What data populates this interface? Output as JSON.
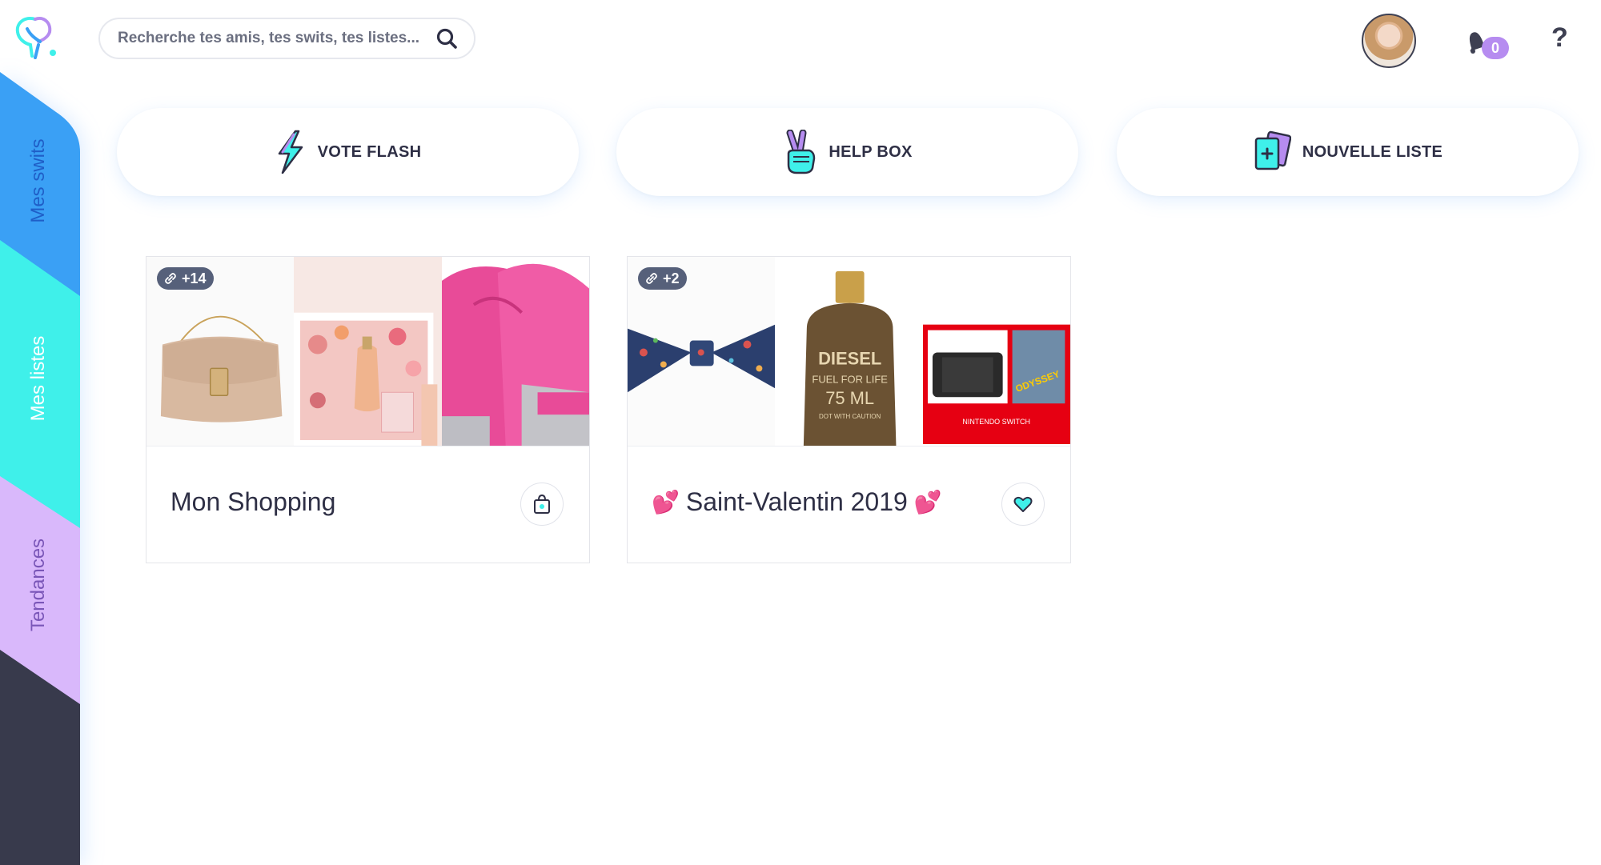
{
  "header": {
    "logo_name": "switch-logo",
    "search": {
      "placeholder": "Recherche tes amis, tes swits, tes listes..."
    },
    "notifications": {
      "count": "0"
    },
    "help_label": "?"
  },
  "sidebar": {
    "items": [
      {
        "label": "Mes swits",
        "color": "#3aa0f5"
      },
      {
        "label": "Mes listes",
        "color": "#3ff0ea"
      },
      {
        "label": "Tendances",
        "color": "#d9b8fb"
      }
    ],
    "bottom_color": "#383a4c"
  },
  "actions": [
    {
      "label": "VOTE FLASH",
      "icon": "lightning-icon"
    },
    {
      "label": "HELP BOX",
      "icon": "victory-hand-icon"
    },
    {
      "label": "NOUVELLE LISTE",
      "icon": "new-list-cards-icon"
    }
  ],
  "lists": [
    {
      "title": "Mon Shopping",
      "count_badge": "+14",
      "prefix_emoji": "",
      "suffix_emoji": "",
      "images": [
        "beige-handbag",
        "jean-paul-gaultier-perfume-set",
        "pink-boxing-gloves"
      ],
      "icon": "shopping-bag-icon"
    },
    {
      "title": "Saint-Valentin 2019",
      "count_badge": "+2",
      "prefix_emoji": "💕",
      "suffix_emoji": "💕",
      "images": [
        "floral-bow-tie",
        "diesel-fuel-for-life-perfume",
        "nintendo-switch-mario-odyssey-bundle"
      ],
      "icon": "heart-icon"
    }
  ],
  "product_text": {
    "perfume_line1": "DIESEL",
    "perfume_line2": "FUEL FOR LIFE",
    "perfume_line3": "75 ML",
    "perfume_line4": "DOT WITH CAUTION",
    "console_box": "NINTENDO SWITCH",
    "console_game": "ODYSSEY"
  },
  "colors": {
    "accent_blue": "#3aa0f5",
    "accent_cyan": "#3ff0ea",
    "accent_purple": "#b68cf0",
    "text_dark": "#2e2f45"
  }
}
